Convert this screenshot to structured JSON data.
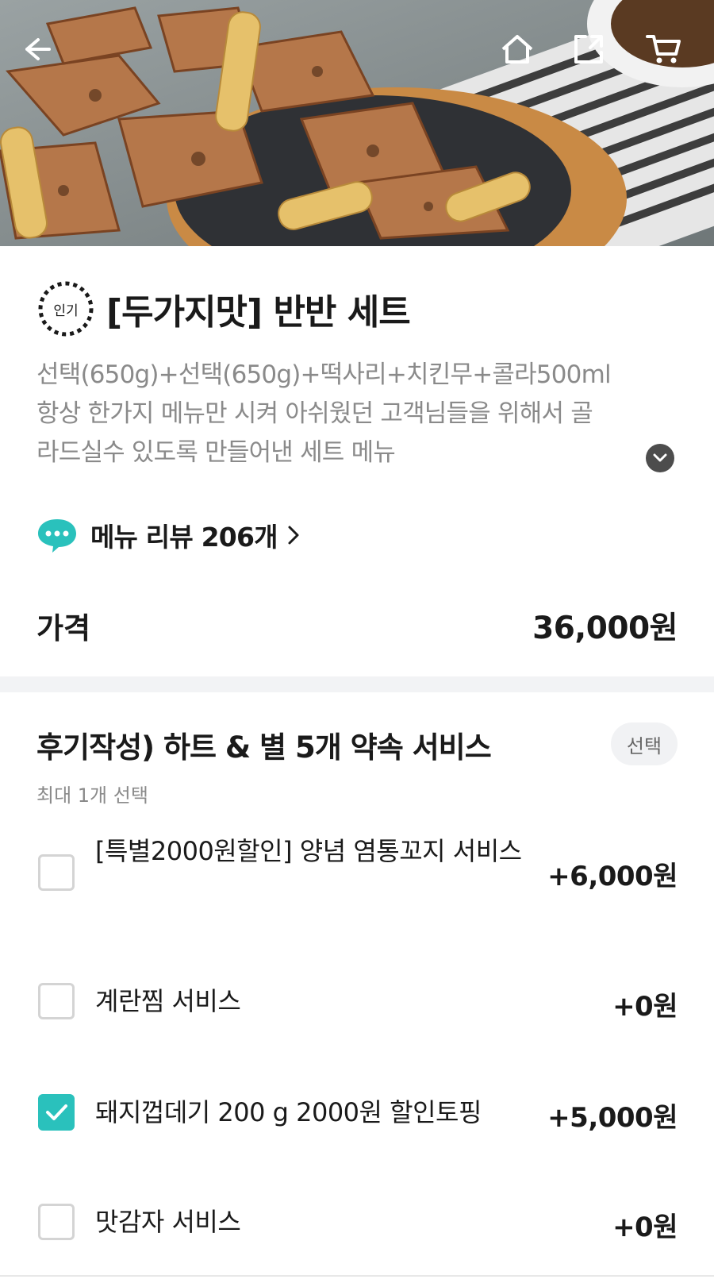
{
  "hero": {
    "icons": [
      "back-arrow-icon",
      "home-icon",
      "share-icon",
      "cart-icon"
    ]
  },
  "product": {
    "badge": "인기",
    "title": "[두가지맛] 반반 세트",
    "description_lines": [
      "선택(650g)+선택(650g)+떡사리+치킨무+콜라500ml",
      "항상 한가지 메뉴만 시켜 아쉬웠던 고객님들을 위해서 골",
      "라드실수 있도록 만들어낸 세트 메뉴"
    ],
    "review_label": "메뉴 리뷰 206개",
    "price_label": "가격",
    "price_value": "36,000원"
  },
  "option_group": {
    "title": "후기작성) 하트 & 별 5개 약속 서비스",
    "badge": "선택",
    "subtitle": "최대 1개 선택",
    "options": [
      {
        "label": "[특별2000원할인] 양념 염통꼬지 서비스",
        "price": "+6,000원",
        "checked": false
      },
      {
        "label": "계란찜 서비스",
        "price": "+0원",
        "checked": false
      },
      {
        "label": "돼지껍데기 200 g 2000원 할인토핑",
        "price": "+5,000원",
        "checked": true
      },
      {
        "label": "맛감자 서비스",
        "price": "+0원",
        "checked": false
      }
    ]
  },
  "colors": {
    "accent": "#2ac1bc",
    "muted_text": "#8a8a8a",
    "band": "#f2f3f5"
  }
}
